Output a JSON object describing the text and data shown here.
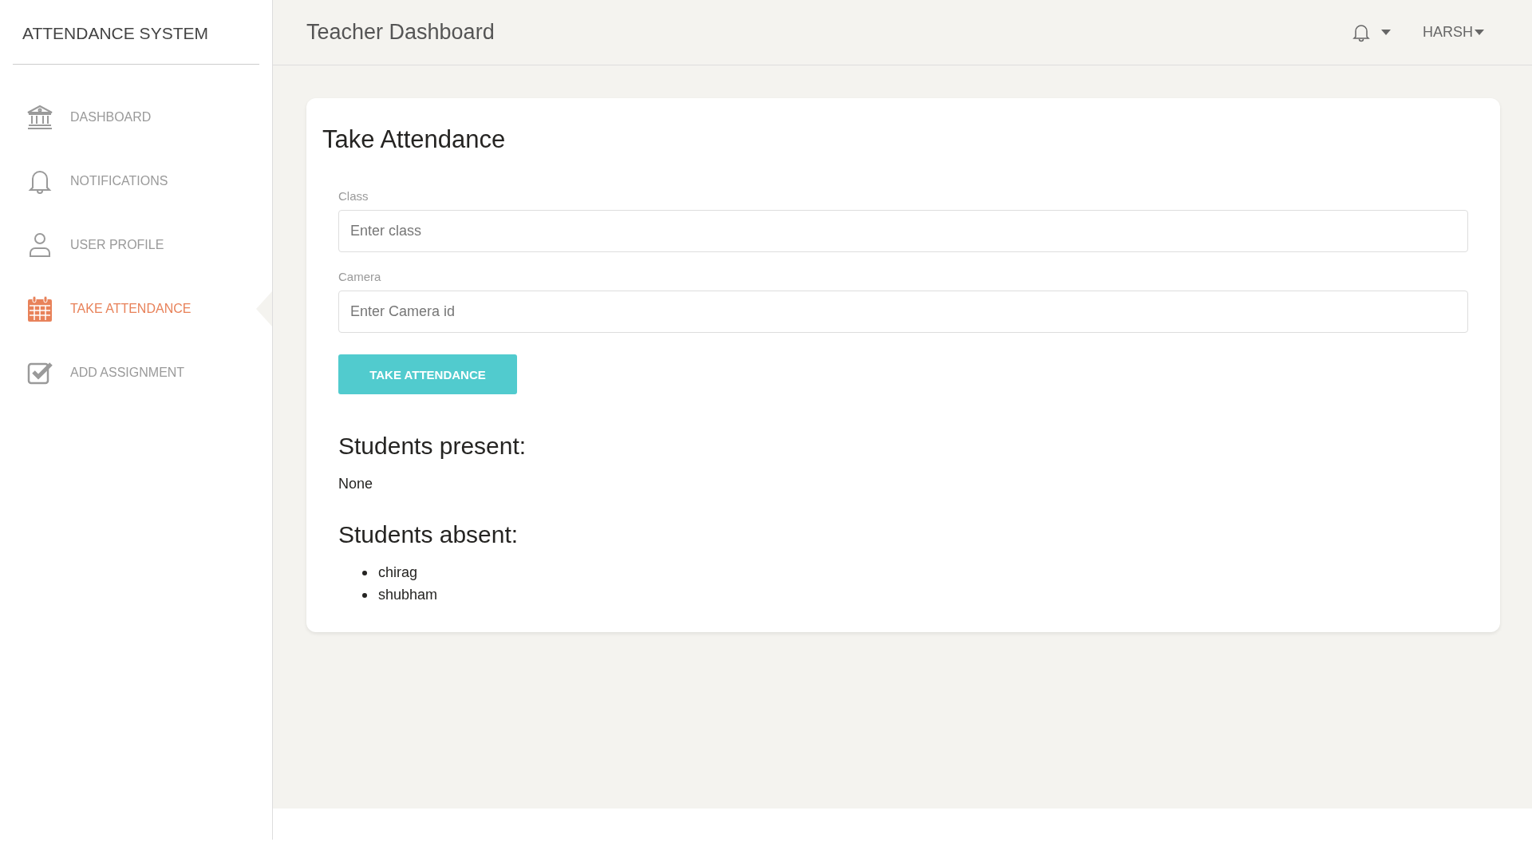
{
  "sidebar": {
    "brand": "ATTENDANCE SYSTEM",
    "items": [
      {
        "label": "DASHBOARD",
        "selected": false
      },
      {
        "label": "NOTIFICATIONS",
        "selected": false
      },
      {
        "label": "USER PROFILE",
        "selected": false
      },
      {
        "label": "TAKE ATTENDANCE",
        "selected": true
      },
      {
        "label": "ADD ASSIGNMENT",
        "selected": false
      }
    ]
  },
  "header": {
    "title": "Teacher Dashboard",
    "user": "HARSH"
  },
  "card": {
    "title": "Take Attendance",
    "fields": [
      {
        "label": "Class",
        "placeholder": "Enter class"
      },
      {
        "label": "Camera",
        "placeholder": "Enter Camera id"
      }
    ],
    "button": "TAKE ATTENDANCE",
    "present_heading": "Students present:",
    "present_text": "None",
    "absent_heading": "Students absent:",
    "absent": [
      "chirag",
      "shubham"
    ]
  }
}
